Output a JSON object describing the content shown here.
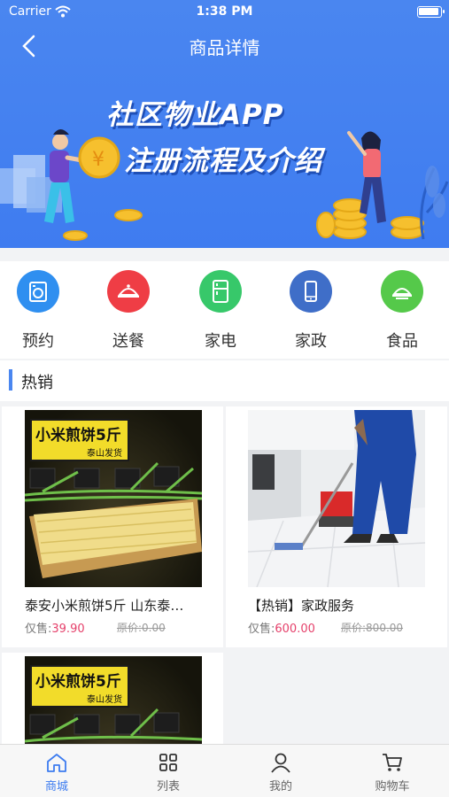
{
  "status_bar": {
    "carrier": "Carrier",
    "time": "1:38 PM"
  },
  "navbar": {
    "title": "商品详情"
  },
  "banner": {
    "line1": "社区物业APP",
    "line2": "注册流程及介绍",
    "coin_symbol": "¥"
  },
  "categories": [
    {
      "label": "预约",
      "icon": "washing-machine-icon",
      "color": "#2f8ff0"
    },
    {
      "label": "送餐",
      "icon": "food-cover-icon",
      "color": "#ef3d45"
    },
    {
      "label": "家电",
      "icon": "fridge-icon",
      "color": "#37c86a"
    },
    {
      "label": "家政",
      "icon": "phone-icon",
      "color": "#3f6ec8"
    },
    {
      "label": "食品",
      "icon": "dish-icon",
      "color": "#55c94a"
    }
  ],
  "section": {
    "title": "热销"
  },
  "products": [
    {
      "name": "泰安小米煎饼5斤 山东泰…",
      "price_label": "仅售:",
      "price": "39.90",
      "original": "原价:0.00",
      "tag": "小米煎饼5斤",
      "tag_sub": "泰山发货"
    },
    {
      "name": "【热销】家政服务",
      "price_label": "仅售:",
      "price": "600.00",
      "original": "原价:800.00"
    },
    {
      "tag": "小米煎饼5斤",
      "tag_sub": "泰山发货"
    }
  ],
  "tabbar": [
    {
      "label": "商城",
      "icon": "home-icon",
      "active": true
    },
    {
      "label": "列表",
      "icon": "grid-icon",
      "active": false
    },
    {
      "label": "我的",
      "icon": "user-icon",
      "active": false
    },
    {
      "label": "购物车",
      "icon": "cart-icon",
      "active": false
    }
  ],
  "colors": {
    "primary": "#4a86f0",
    "price": "#e5416b"
  }
}
